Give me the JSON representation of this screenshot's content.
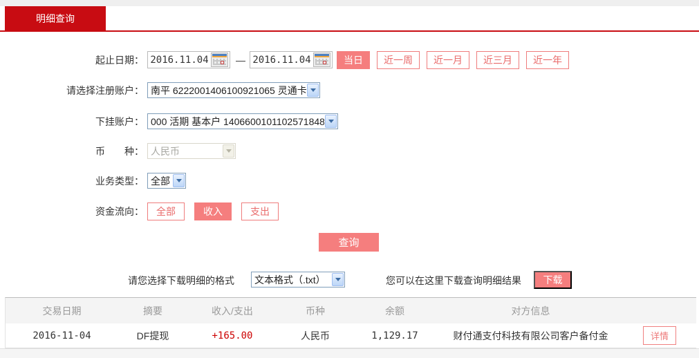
{
  "colors": {
    "brand_red": "#c80c12",
    "button_salmon": "#f57e7e",
    "outline_pink": "#ef7c7c",
    "amount_red": "#cc0000",
    "header_text_gray": "#9a9a9a"
  },
  "tab": {
    "label": "明细查询"
  },
  "form": {
    "date_range": {
      "label": "起止日期：",
      "start_value": "2016.11.04",
      "separator": "—",
      "end_value": "2016.11.04",
      "quick_buttons": [
        {
          "label": "当日",
          "active": true
        },
        {
          "label": "近一周",
          "active": false
        },
        {
          "label": "近一月",
          "active": false
        },
        {
          "label": "近三月",
          "active": false
        },
        {
          "label": "近一年",
          "active": false
        }
      ]
    },
    "register_account": {
      "label": "请选择注册账户：",
      "value": "南平 6222001406100921065 灵通卡"
    },
    "sub_account": {
      "label": "下挂账户：",
      "value": "000 活期 基本户 1406600101102571848"
    },
    "currency": {
      "label": "币　　种：",
      "value": "人民币",
      "disabled": true
    },
    "business_type": {
      "label": "业务类型：",
      "value": "全部"
    },
    "fund_flow": {
      "label": "资金流向：",
      "buttons": [
        {
          "label": "全部",
          "active": false
        },
        {
          "label": "收入",
          "active": true
        },
        {
          "label": "支出",
          "active": false
        }
      ]
    },
    "query_button": "查询"
  },
  "download": {
    "format_label": "请您选择下载明细的格式",
    "format_value": "文本格式（.txt）",
    "hint": "您可以在这里下载查询明细结果",
    "button": "下载"
  },
  "table": {
    "headers": [
      "交易日期",
      "摘要",
      "收入/支出",
      "币种",
      "余额",
      "对方信息"
    ],
    "rows": [
      {
        "date": "2016-11-04",
        "summary": "DF提现",
        "amount": "+165.00",
        "currency": "人民币",
        "balance": "1,129.17",
        "counterparty": "财付通支付科技有限公司客户备付金",
        "action": "详情"
      }
    ]
  }
}
